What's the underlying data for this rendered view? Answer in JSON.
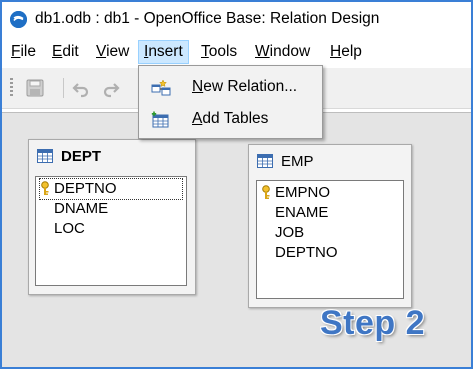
{
  "window": {
    "title": "db1.odb : db1 - OpenOffice Base: Relation Design",
    "app_icon": "openoffice-logo"
  },
  "menubar": {
    "items": [
      {
        "key": "F",
        "rest": "ile"
      },
      {
        "key": "E",
        "rest": "dit"
      },
      {
        "key": "V",
        "rest": "iew"
      },
      {
        "key": "I",
        "rest": "nsert"
      },
      {
        "key": "T",
        "rest": "ools"
      },
      {
        "key": "W",
        "rest": "indow"
      },
      {
        "key": "H",
        "rest": "elp"
      }
    ],
    "active_index": 3
  },
  "toolbar": {
    "buttons": [
      "save-icon",
      "undo-icon",
      "redo-icon"
    ]
  },
  "insert_menu": {
    "items": [
      {
        "key": "N",
        "rest": "ew Relation...",
        "icon": "new-relation-icon"
      },
      {
        "key": "A",
        "rest": "dd Tables",
        "icon": "add-tables-icon"
      }
    ]
  },
  "tables": [
    {
      "name": "DEPT",
      "fields": [
        {
          "name": "DEPTNO",
          "primary_key": true,
          "selected": true
        },
        {
          "name": "DNAME"
        },
        {
          "name": "LOC"
        }
      ]
    },
    {
      "name": "EMP",
      "fields": [
        {
          "name": "EMPNO",
          "primary_key": true
        },
        {
          "name": "ENAME"
        },
        {
          "name": "JOB"
        },
        {
          "name": "DEPTNO"
        }
      ]
    }
  ],
  "overlay": {
    "step_label": "Step 2"
  },
  "colors": {
    "accent": "#3a7fd6",
    "menu_highlight": "#cce8ff",
    "step_label": "#3f76c4"
  }
}
